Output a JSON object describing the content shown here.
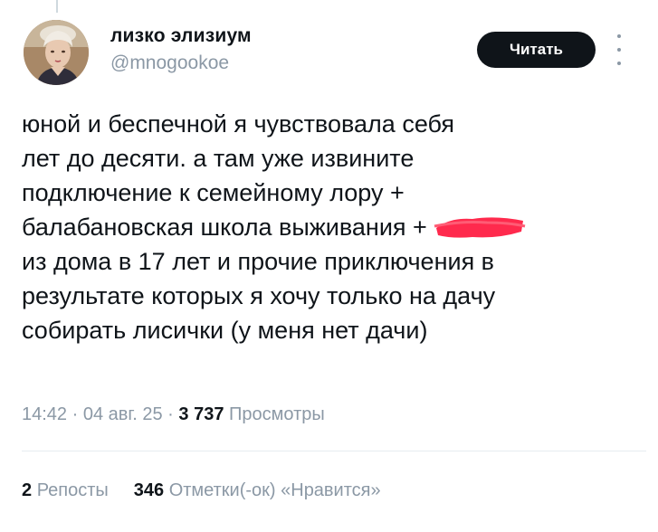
{
  "author": {
    "display_name": "лизко элизиум",
    "handle": "@mnogookoe",
    "avatar_icon": "portrait-avatar"
  },
  "actions": {
    "read_label": "Читать",
    "more_icon": "more-vertical-icon"
  },
  "tweet": {
    "lines": [
      "юной и беспечной я чувствовала себя",
      "лет до десяти. а там уже извините",
      "подключение к семейному лору +",
      "балабановская школа выживания +",
      "из дома в 17 лет и прочие приключения в",
      "результате которых я хочу только на дачу",
      "собирать лисички (у меня нет дачи)"
    ]
  },
  "meta": {
    "time": "14:42",
    "separator": " · ",
    "date": "04 авг. 25",
    "views_count": "3 737",
    "views_label": "Просмотры"
  },
  "stats": {
    "reposts_count": "2",
    "reposts_label": "Репосты",
    "likes_count": "346",
    "likes_label": "Отметки(-ок) «Нравится»"
  },
  "colors": {
    "text": "#0f1419",
    "secondary": "#8b98a5",
    "button_bg": "#0f1419",
    "button_text": "#ffffff",
    "redaction": "#ff2a4d",
    "divider": "#e6ecf0"
  }
}
